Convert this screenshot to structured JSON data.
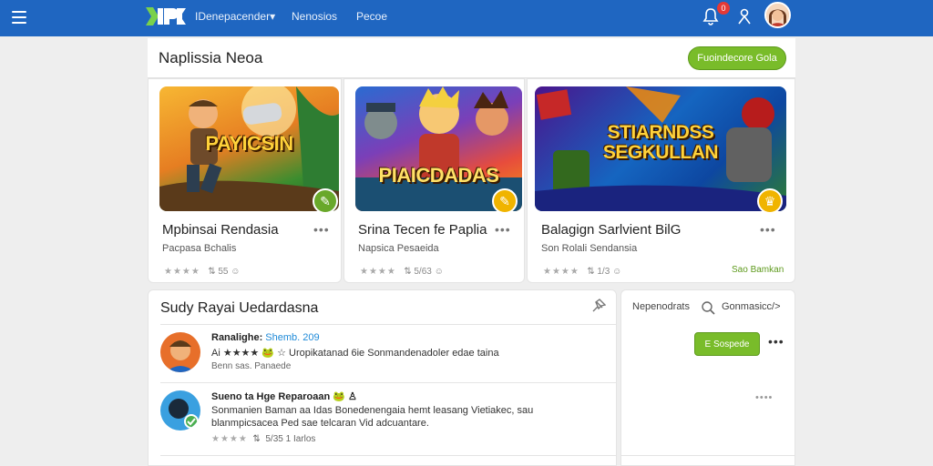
{
  "topbar": {
    "brand_menu": "IDenepacender",
    "brand_caret": "▾",
    "nav": [
      "Nenosios",
      "Pecoe"
    ],
    "notification_count": "0"
  },
  "header": {
    "title": "Naplissia Neoa",
    "primary_button": "Fuoindecore Gola"
  },
  "cards": [
    {
      "image_title": "PAYICSIN",
      "title": "Mpbinsai Rendasia",
      "more": "•••",
      "subtitle": "Pacpasa Bchalis",
      "stars": "★★★★",
      "meta_icon": "⇅",
      "meta_value": "55",
      "meta_icon2": "☺",
      "tag": "",
      "fav_color": "#69a82a",
      "fav_icon": "✎"
    },
    {
      "image_title": "PIAICDADAS",
      "title": "Srina Tecen fe Paplia",
      "more": "•••",
      "subtitle": "Napsica Pesaeida",
      "stars": "★★★★",
      "meta_icon": "⇅",
      "meta_value": "5/63",
      "meta_icon2": "☺",
      "tag": "",
      "fav_color": "#f0b400",
      "fav_icon": "✎"
    },
    {
      "image_title": "STIARNDSS SEGKULLAN",
      "title": "Balagign Sarlvient BilG",
      "more": "•••",
      "subtitle": "Son Rolali Sendansia",
      "stars": "★★★★",
      "meta_icon": "⇅",
      "meta_value": "1/3",
      "meta_icon2": "☺",
      "tag": "Sao Bamkan",
      "fav_color": "#f0b400",
      "fav_icon": "♛"
    }
  ],
  "feed": {
    "title": "Sudy Rayai Uedardasna",
    "posts": [
      {
        "name": "Ranalighe:",
        "tag": "Shemb. 209",
        "text": "Ai ★★★★ 🐸 ☆ Uropikatanad 6ie Sonmandenadoler edae taina",
        "foot": "Benn sas. Panaede",
        "avatar_color": "#e76f2a"
      },
      {
        "name": "Sueno ta Hge Reparoaan 🐸 ♙",
        "tag": "",
        "text": "Sonmanien Baman aa Idas Bonedenengaia hemt leasang Vietiakec, sau",
        "text2": "blanmpicsacea Ped sae telcaran Vid adcuantare.",
        "stars": "★★★★",
        "foot_icon": "⇅",
        "foot": "5/35  1 Iarlos",
        "avatar_color": "#3aa0e0"
      }
    ]
  },
  "side": {
    "label": "Nepenodrats",
    "link": "Gonmasicc/>",
    "button": "E Sospede",
    "more": "•••",
    "more2": "••••"
  },
  "colors": {
    "topbar": "#1f66c1",
    "accent_green": "#79bc2a",
    "badge_red": "#e53935"
  },
  "icons": {
    "menu": "hamburger-icon",
    "bell": "bell-icon",
    "user": "person-icon",
    "pin": "pin-icon",
    "search": "search-icon"
  }
}
